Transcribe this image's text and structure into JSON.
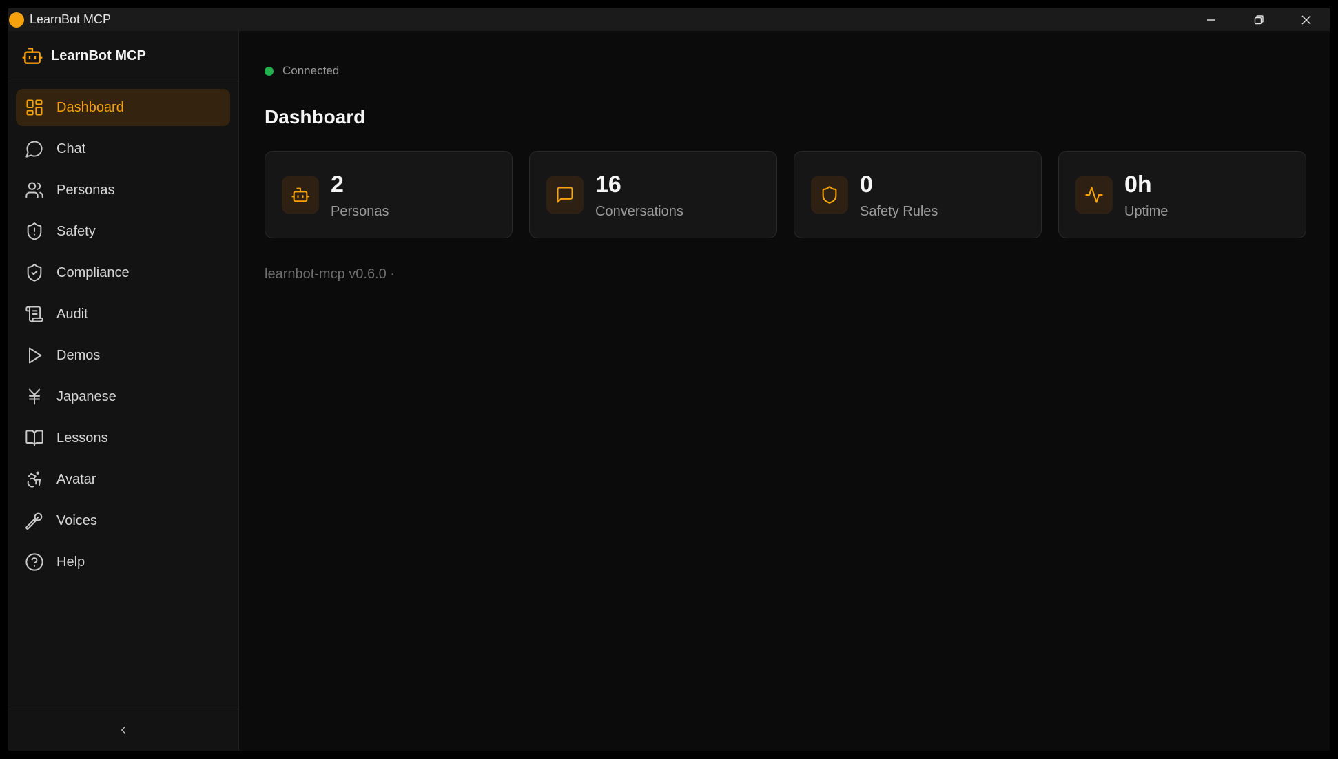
{
  "window": {
    "title": "LearnBot MCP"
  },
  "brand": {
    "name": "LearnBot MCP"
  },
  "sidebar": {
    "items": [
      {
        "label": "Dashboard",
        "icon": "dashboard-icon",
        "active": true
      },
      {
        "label": "Chat",
        "icon": "chat-icon"
      },
      {
        "label": "Personas",
        "icon": "users-icon"
      },
      {
        "label": "Safety",
        "icon": "shield-alert-icon"
      },
      {
        "label": "Compliance",
        "icon": "shield-check-icon"
      },
      {
        "label": "Audit",
        "icon": "scroll-icon"
      },
      {
        "label": "Demos",
        "icon": "play-icon"
      },
      {
        "label": "Japanese",
        "icon": "yen-icon"
      },
      {
        "label": "Lessons",
        "icon": "book-icon"
      },
      {
        "label": "Avatar",
        "icon": "accessibility-icon"
      },
      {
        "label": "Voices",
        "icon": "microphone-icon"
      },
      {
        "label": "Help",
        "icon": "help-icon"
      }
    ]
  },
  "status": {
    "text": "Connected",
    "color": "#22b14c"
  },
  "main": {
    "title": "Dashboard",
    "stats": [
      {
        "value": "2",
        "label": "Personas",
        "icon": "bot-icon"
      },
      {
        "value": "16",
        "label": "Conversations",
        "icon": "message-icon"
      },
      {
        "value": "0",
        "label": "Safety Rules",
        "icon": "shield-icon"
      },
      {
        "value": "0h",
        "label": "Uptime",
        "icon": "activity-icon"
      }
    ],
    "version": "learnbot-mcp v0.6.0 ·"
  },
  "colors": {
    "accent": "#f5a20c",
    "background": "#0b0b0c",
    "sidebar": "#131314"
  }
}
